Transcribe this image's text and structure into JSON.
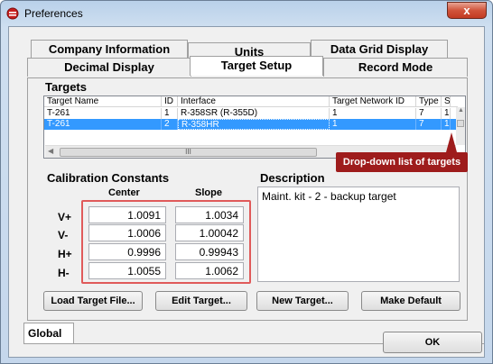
{
  "window": {
    "title": "Preferences",
    "close_label": "x"
  },
  "tabs_row1": [
    {
      "label": "Company Information"
    },
    {
      "label": "Units"
    },
    {
      "label": "Data Grid Display"
    }
  ],
  "tabs_row2": [
    {
      "label": "Decimal Display"
    },
    {
      "label": "Target Setup",
      "active": true
    },
    {
      "label": "Record Mode"
    }
  ],
  "targets": {
    "group_label": "Targets",
    "columns": [
      "Target Name",
      "ID",
      "Interface",
      "Target Network ID",
      "Type",
      "S"
    ],
    "rows": [
      [
        "T-261",
        "1",
        "R-358SR (R-355D)",
        "1",
        "7",
        "1"
      ],
      [
        "T-261",
        "2",
        "R-358HR",
        "1",
        "7",
        "1"
      ]
    ],
    "selected_row": 1,
    "scroll_thumb_label": "III",
    "tooltip": "Drop-down list of targets"
  },
  "calibration": {
    "group_label": "Calibration Constants",
    "center_label": "Center",
    "slope_label": "Slope",
    "rows": [
      {
        "label": "V+",
        "center": "1.0091",
        "slope": "1.0034"
      },
      {
        "label": "V-",
        "center": "1.0006",
        "slope": "1.00042"
      },
      {
        "label": "H+",
        "center": "0.9996",
        "slope": "0.99943"
      },
      {
        "label": "H-",
        "center": "1.0055",
        "slope": "1.0062"
      }
    ]
  },
  "description": {
    "group_label": "Description",
    "value": "Maint. kit - 2 - backup target"
  },
  "buttons": {
    "load": "Load Target File...",
    "edit": "Edit Target...",
    "new": "New Target...",
    "default": "Make Default",
    "ok": "OK"
  },
  "footer": {
    "global_tab": "Global"
  },
  "colors": {
    "selection": "#3399ff",
    "tooltip": "#9e1c1c",
    "highlight_box": "#e05a5a"
  }
}
